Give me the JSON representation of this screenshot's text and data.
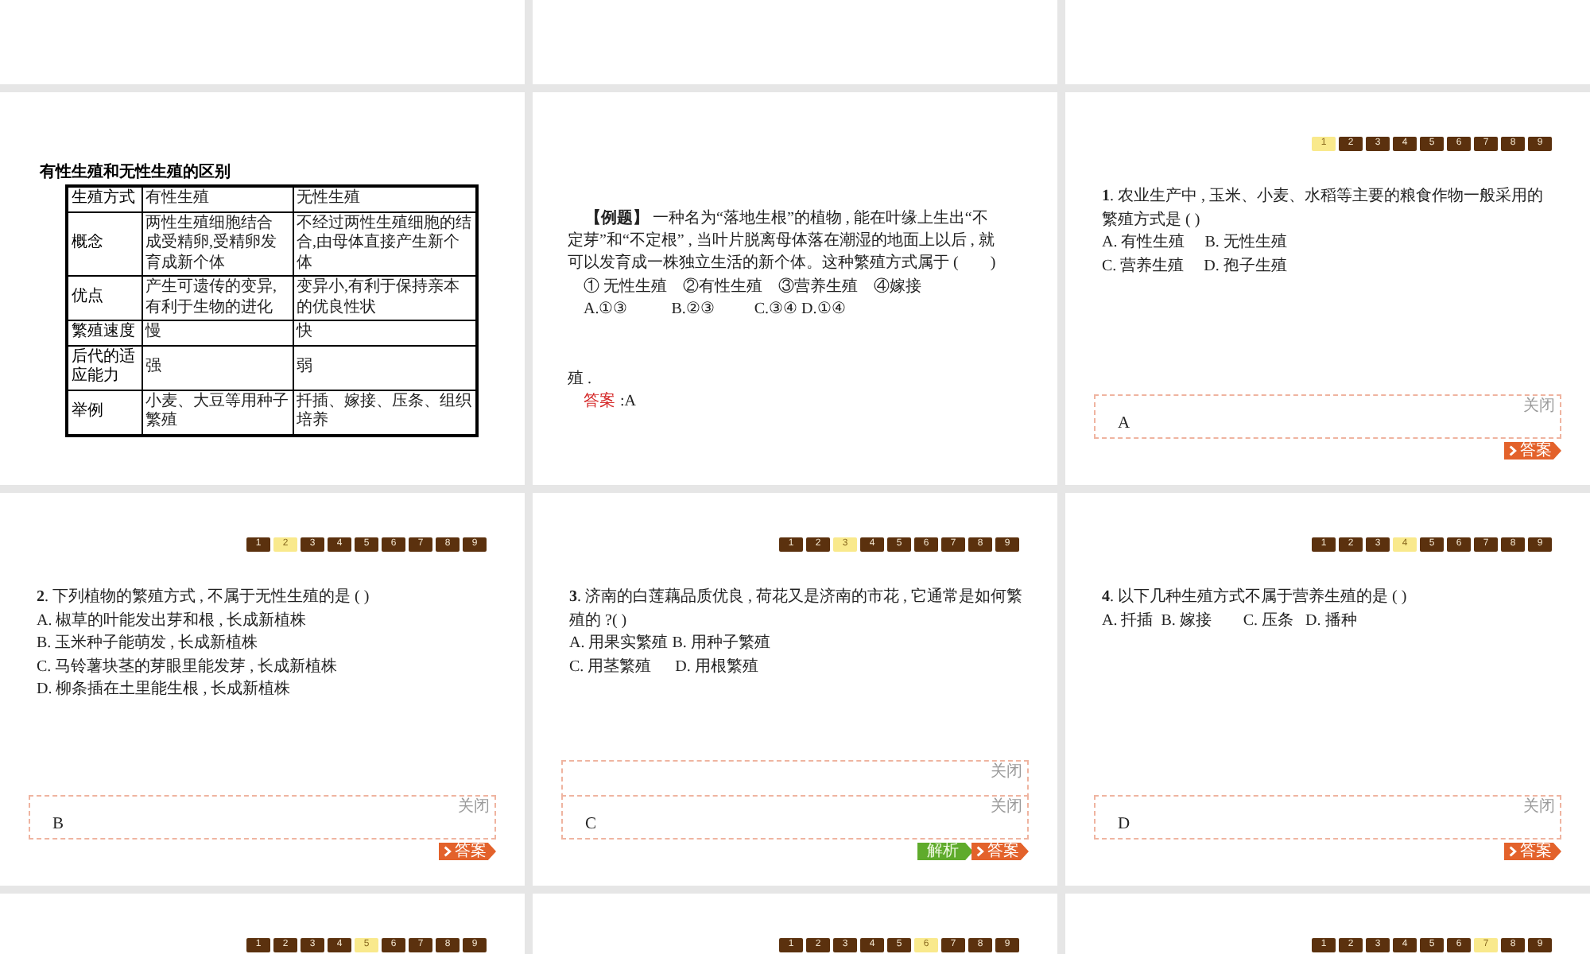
{
  "slides": [
    {
      "kind": "blank"
    },
    {
      "kind": "blank"
    },
    {
      "kind": "blank"
    },
    {
      "kind": "table",
      "title": "有性生殖和无性生殖的区别",
      "rows": [
        [
          [
            "生殖方式"
          ],
          [
            "有性生殖"
          ],
          [
            "无性生殖"
          ]
        ],
        [
          [
            "概念"
          ],
          [
            "两性生殖细胞结合",
            "成受精卵,受精卵发",
            "育成新个体"
          ],
          [
            "不经过两性生殖细胞的结",
            "合,由母体直接产生新个",
            "体"
          ]
        ],
        [
          [
            "优点"
          ],
          [
            "产生可遗传的变异,",
            "有利于生物的进化"
          ],
          [
            "变异小,有利于保持亲本",
            "的优良性状"
          ]
        ],
        [
          [
            "繁殖速度"
          ],
          [
            "慢"
          ],
          [
            "快"
          ]
        ],
        [
          [
            "后代的适",
            "应能力"
          ],
          [
            "强"
          ],
          [
            "弱"
          ]
        ],
        [
          [
            "举例"
          ],
          [
            "小麦、大豆等用种子",
            "繁殖"
          ],
          [
            "扦插、嫁接、压条、组织",
            "培养"
          ]
        ]
      ]
    },
    {
      "kind": "example",
      "question": [
        "**【例题】** 一种名为“落地生根”的植物 , 能在叶缘上生出“不",
        "定芽”和“不定根” , 当叶片脱离母体落在潮湿的地面上以后 , 就",
        "可以发育成一株独立生活的新个体。这种繁殖方式属于 (        )"
      ],
      "options": [
        "① 无性生殖    ②有性生殖    ③营养生殖    ④嫁接",
        "A.①③           B.②③          C.③④ D.①④"
      ],
      "fragment": "殖 .",
      "answer": {
        "label": "答案",
        "value": ":A"
      }
    },
    {
      "kind": "quiz",
      "pager": [
        {
          "label": "1",
          "selected": true
        },
        {
          "label": "2",
          "selected": false
        },
        {
          "label": "3",
          "selected": false
        },
        {
          "label": "4",
          "selected": false
        },
        {
          "label": "5",
          "selected": false
        },
        {
          "label": "6",
          "selected": false
        },
        {
          "label": "7",
          "selected": false
        },
        {
          "label": "8",
          "selected": false
        },
        {
          "label": "9",
          "selected": false
        }
      ],
      "question": [
        "**1**. 农业生产中 , 玉米、小麦、水稻等主要的粮食作物一般采用的",
        "繁殖方式是 ( )"
      ],
      "options": [
        "A. 有性生殖     B. 无性生殖",
        "C. 营养生殖     D. 孢子生殖"
      ],
      "panels": [
        {
          "kind": "answer",
          "close_label": "关闭",
          "text": "A"
        }
      ],
      "buttons": [
        {
          "kind": "answer",
          "label": "答案"
        }
      ]
    },
    {
      "kind": "quiz",
      "pager": [
        {
          "label": "1",
          "selected": false
        },
        {
          "label": "2",
          "selected": true
        },
        {
          "label": "3",
          "selected": false
        },
        {
          "label": "4",
          "selected": false
        },
        {
          "label": "5",
          "selected": false
        },
        {
          "label": "6",
          "selected": false
        },
        {
          "label": "7",
          "selected": false
        },
        {
          "label": "8",
          "selected": false
        },
        {
          "label": "9",
          "selected": false
        }
      ],
      "question": [
        "**2**. 下列植物的繁殖方式 , 不属于无性生殖的是 ( )"
      ],
      "options": [
        "A. 椒草的叶能发出芽和根 , 长成新植株",
        "B. 玉米种子能萌发 , 长成新植株",
        "C. 马铃薯块茎的芽眼里能发芽 , 长成新植株",
        "D. 柳条插在土里能生根 , 长成新植株"
      ],
      "panels": [
        {
          "kind": "answer",
          "close_label": "关闭",
          "text": "B"
        }
      ],
      "buttons": [
        {
          "kind": "answer",
          "label": "答案"
        }
      ]
    },
    {
      "kind": "quiz",
      "pager": [
        {
          "label": "1",
          "selected": false
        },
        {
          "label": "2",
          "selected": false
        },
        {
          "label": "3",
          "selected": true
        },
        {
          "label": "4",
          "selected": false
        },
        {
          "label": "5",
          "selected": false
        },
        {
          "label": "6",
          "selected": false
        },
        {
          "label": "7",
          "selected": false
        },
        {
          "label": "8",
          "selected": false
        },
        {
          "label": "9",
          "selected": false
        }
      ],
      "question": [
        "**3**. 济南的白莲藕品质优良 , 荷花又是济南的市花 , 它通常是如何繁",
        "殖的 ?( )"
      ],
      "options": [
        "A. 用果实繁殖 B. 用种子繁殖",
        "C. 用茎繁殖      D. 用根繁殖"
      ],
      "panels": [
        {
          "kind": "explanation",
          "close_label": "关闭"
        },
        {
          "kind": "answer",
          "close_label": "关闭",
          "text": "C"
        }
      ],
      "buttons": [
        {
          "kind": "explanation",
          "label": "解析"
        },
        {
          "kind": "answer",
          "label": "答案"
        }
      ]
    },
    {
      "kind": "quiz",
      "pager": [
        {
          "label": "1",
          "selected": false
        },
        {
          "label": "2",
          "selected": false
        },
        {
          "label": "3",
          "selected": false
        },
        {
          "label": "4",
          "selected": true
        },
        {
          "label": "5",
          "selected": false
        },
        {
          "label": "6",
          "selected": false
        },
        {
          "label": "7",
          "selected": false
        },
        {
          "label": "8",
          "selected": false
        },
        {
          "label": "9",
          "selected": false
        }
      ],
      "question": [
        "**4**. 以下几种生殖方式不属于营养生殖的是 ( )"
      ],
      "options": [
        "A. 扦插  B. 嫁接        C. 压条   D. 播种"
      ],
      "panels": [
        {
          "kind": "answer",
          "close_label": "关闭",
          "text": "D"
        }
      ],
      "buttons": [
        {
          "kind": "answer",
          "label": "答案"
        }
      ]
    },
    {
      "kind": "quiz",
      "pager": [
        {
          "label": "1",
          "selected": false
        },
        {
          "label": "2",
          "selected": false
        },
        {
          "label": "3",
          "selected": false
        },
        {
          "label": "4",
          "selected": false
        },
        {
          "label": "5",
          "selected": true
        },
        {
          "label": "6",
          "selected": false
        },
        {
          "label": "7",
          "selected": false
        },
        {
          "label": "8",
          "selected": false
        },
        {
          "label": "9",
          "selected": false
        }
      ]
    },
    {
      "kind": "quiz",
      "pager": [
        {
          "label": "1",
          "selected": false
        },
        {
          "label": "2",
          "selected": false
        },
        {
          "label": "3",
          "selected": false
        },
        {
          "label": "4",
          "selected": false
        },
        {
          "label": "5",
          "selected": false
        },
        {
          "label": "6",
          "selected": true
        },
        {
          "label": "7",
          "selected": false
        },
        {
          "label": "8",
          "selected": false
        },
        {
          "label": "9",
          "selected": false
        }
      ]
    },
    {
      "kind": "quiz",
      "pager": [
        {
          "label": "1",
          "selected": false
        },
        {
          "label": "2",
          "selected": false
        },
        {
          "label": "3",
          "selected": false
        },
        {
          "label": "4",
          "selected": false
        },
        {
          "label": "5",
          "selected": false
        },
        {
          "label": "6",
          "selected": false
        },
        {
          "label": "7",
          "selected": true
        },
        {
          "label": "8",
          "selected": false
        },
        {
          "label": "9",
          "selected": false
        }
      ]
    }
  ]
}
